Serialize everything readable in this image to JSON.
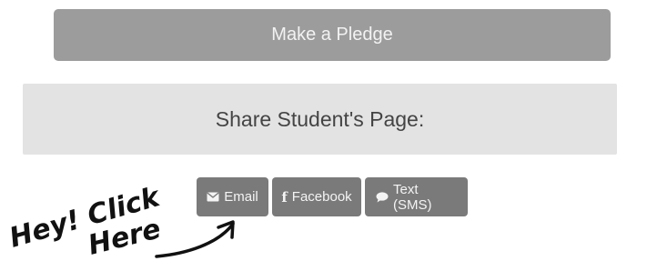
{
  "pledge": {
    "label": "Make a Pledge"
  },
  "share": {
    "title": "Share Student's Page:",
    "buttons": {
      "email": {
        "label": "Email",
        "icon": "envelope-icon"
      },
      "facebook": {
        "label": "Facebook",
        "icon": "facebook-icon"
      },
      "sms": {
        "label": "Text (SMS)",
        "icon": "chat-bubble-icon"
      }
    }
  },
  "annotation": {
    "line1": "Hey! Click",
    "line2": "Here"
  },
  "colors": {
    "pledge_button": "#9c9c9c",
    "share_panel": "#e3e3e3",
    "share_button": "#7a7a7a"
  }
}
